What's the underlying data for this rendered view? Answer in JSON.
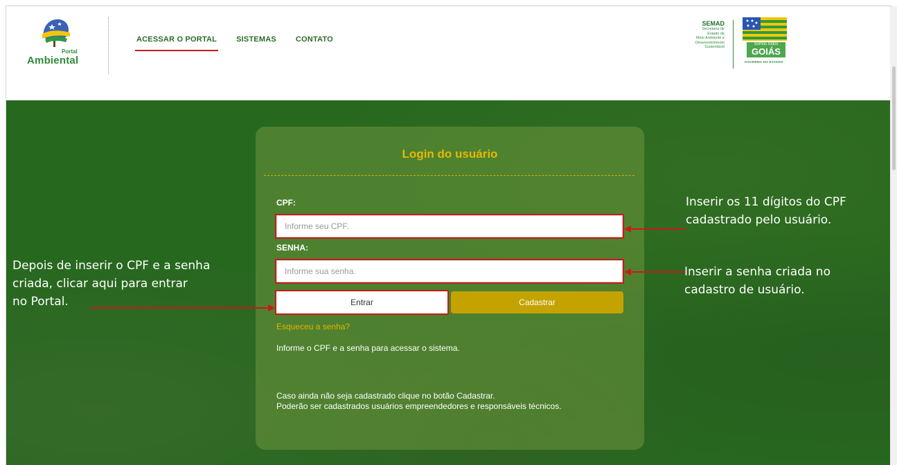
{
  "header": {
    "logo": {
      "small": "Portal",
      "big": "Ambiental",
      "icon": "portal-ambiental-logo"
    },
    "nav": [
      {
        "label": "ACESSAR O PORTAL",
        "active": true
      },
      {
        "label": "SISTEMAS",
        "active": false
      },
      {
        "label": "CONTATO",
        "active": false
      }
    ],
    "semad": {
      "title": "SEMAD",
      "lines": [
        "Secretaria de",
        "Estado de",
        "Meio Ambiente e",
        "Desenvolvimento",
        "Sustentável"
      ]
    },
    "goias": {
      "small": "Somos todos",
      "big": "GOIÁS",
      "caption": "GOVERNO DO ESTADO"
    }
  },
  "login": {
    "title": "Login do usuário",
    "cpf_label": "CPF:",
    "cpf_placeholder": "Informe seu CPF.",
    "senha_label": "SENHA:",
    "senha_placeholder": "Informe sua senha.",
    "entrar": "Entrar",
    "cadastrar": "Cadastrar",
    "forgot": "Esqueceu a senha?",
    "info1": "Informe o CPF e a senha para acessar o sistema.",
    "info2": "Caso ainda não seja cadastrado clique no botão Cadastrar.",
    "info3": "Poderão ser cadastrados usuários empreendedores e responsáveis técnicos."
  },
  "annotations": {
    "cpf": [
      "Inserir os 11 dígitos do CPF",
      "cadastrado pelo usuário."
    ],
    "senha": [
      "Inserir a senha criada no",
      "cadastro de usuário."
    ],
    "entrar": [
      "Depois de inserir o CPF e a senha",
      "criada, clicar aqui para entrar",
      "no Portal."
    ]
  },
  "colors": {
    "hero": "#27681f",
    "accent": "#c4a300",
    "highlight": "#c91a1a",
    "title": "#e6b800"
  }
}
